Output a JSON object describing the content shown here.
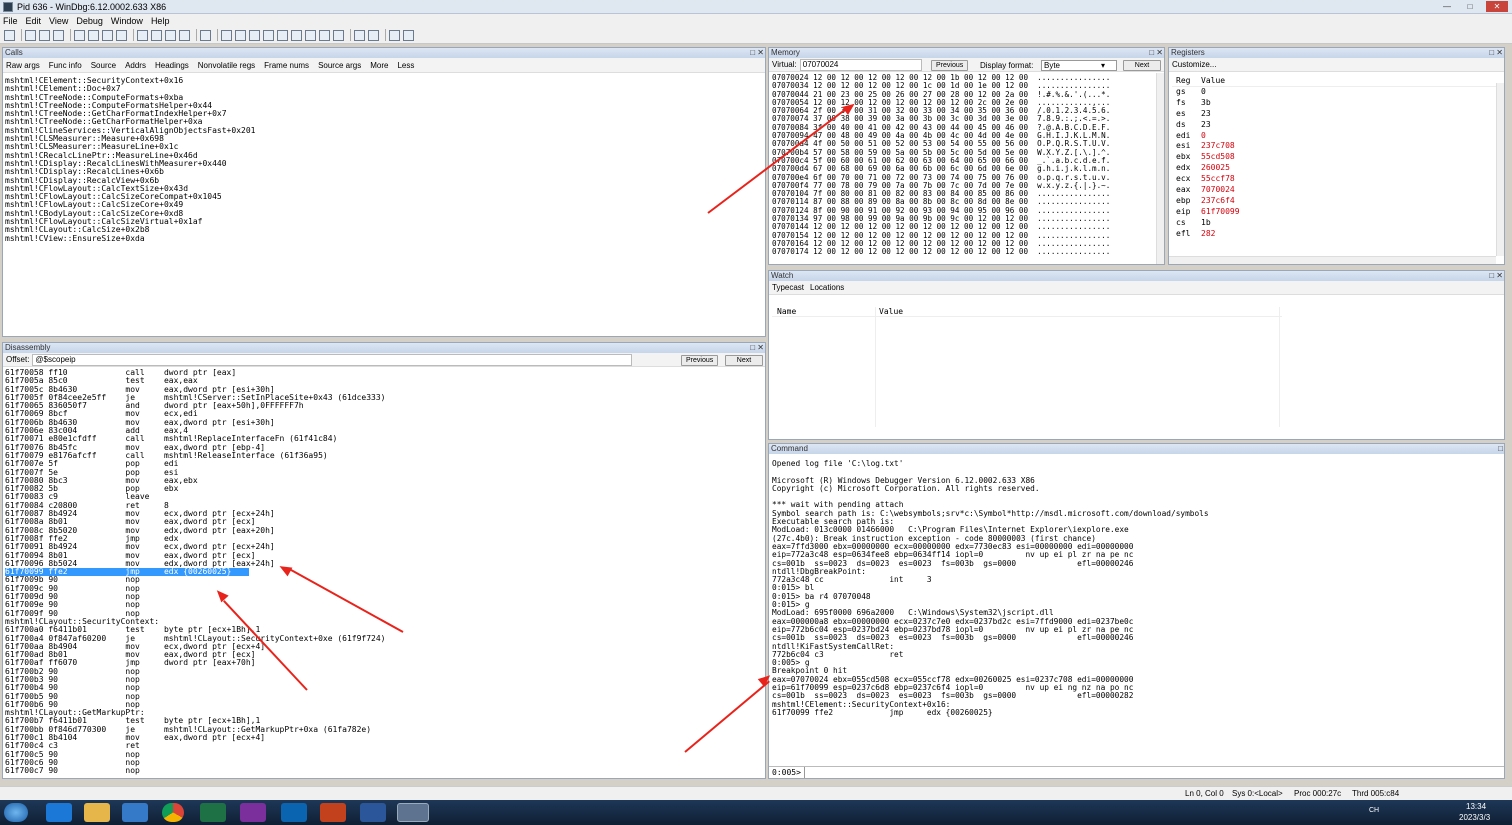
{
  "window": {
    "title": "Pid 636 - WinDbg:6.12.0002.633 X86"
  },
  "menu": [
    "File",
    "Edit",
    "View",
    "Debug",
    "Window",
    "Help"
  ],
  "calls": {
    "title": "Calls",
    "tabs": [
      "Raw args",
      "Func info",
      "Source",
      "Addrs",
      "Headings",
      "Nonvolatile regs",
      "Frame nums",
      "Source args",
      "More",
      "Less"
    ],
    "frames": [
      "mshtml!CElement::SecurityContext+0x16",
      "mshtml!CElement::Doc+0x7",
      "mshtml!CTreeNode::ComputeFormats+0xba",
      "mshtml!CTreeNode::ComputeFormatsHelper+0x44",
      "mshtml!CTreeNode::GetCharFormatIndexHelper+0x7",
      "mshtml!CTreeNode::GetCharFormatHelper+0xa",
      "mshtml!ClineServices::VerticalAlignObjectsFast+0x201",
      "mshtml!CLSMeasurer::Measure+0x698",
      "mshtml!CLSMeasurer::MeasureLine+0x1c",
      "mshtml!CRecalcLinePtr::MeasureLine+0x46d",
      "mshtml!CDisplay::RecalcLinesWithMeasurer+0x440",
      "mshtml!CDisplay::RecalcLines+0x6b",
      "mshtml!CDisplay::RecalcView+0x6b",
      "mshtml!CFlowLayout::CalcTextSize+0x43d",
      "mshtml!CFlowLayout::CalcSizeCoreCompat+0x1045",
      "mshtml!CFlowLayout::CalcSizeCore+0x49",
      "mshtml!CBodyLayout::CalcSizeCore+0xd8",
      "mshtml!CFlowLayout::CalcSizeVirtual+0x1af",
      "mshtml!CLayout::CalcSize+0x2b8",
      "mshtml!CView::EnsureSize+0xda"
    ]
  },
  "disassembly": {
    "title": "Disassembly",
    "offset_label": "Offset:",
    "offset_value": "@$scopeip",
    "previous": "Previous",
    "next": "Next",
    "lines": [
      "61f70058 ff10            call    dword ptr [eax]",
      "61f7005a 85c0            test    eax,eax",
      "61f7005c 8b4630          mov     eax,dword ptr [esi+30h]",
      "61f7005f 0f84cee2e5ff    je      mshtml!CServer::SetInPlaceSite+0x43 (61dce333)",
      "61f70065 836050f7        and     dword ptr [eax+50h],0FFFFFF7h",
      "61f70069 8bcf            mov     ecx,edi",
      "61f7006b 8b4630          mov     eax,dword ptr [esi+30h]",
      "61f7006e 83c004          add     eax,4",
      "61f70071 e80e1cfdff      call    mshtml!ReplaceInterfaceFn (61f41c84)",
      "61f70076 8b45fc          mov     eax,dword ptr [ebp-4]",
      "61f70079 e8176afcff      call    mshtml!ReleaseInterface (61f36a95)",
      "61f7007e 5f              pop     edi",
      "61f7007f 5e              pop     esi",
      "61f70080 8bc3            mov     eax,ebx",
      "61f70082 5b              pop     ebx",
      "61f70083 c9              leave",
      "61f70084 c20800          ret     8",
      "61f70087 8b4924          mov     ecx,dword ptr [ecx+24h]",
      "61f7008a 8b01            mov     eax,dword ptr [ecx]",
      "61f7008c 8b5020          mov     edx,dword ptr [eax+20h]",
      "61f7008f ffe2            jmp     edx",
      "61f70091 8b4924          mov     ecx,dword ptr [ecx+24h]",
      "61f70094 8b01            mov     eax,dword ptr [ecx]",
      "61f70096 8b5024          mov     edx,dword ptr [eax+24h]",
      "61f70099 ffe2            jmp     edx {00260025}",
      "61f7009b 90              nop",
      "61f7009c 90              nop",
      "61f7009d 90              nop",
      "61f7009e 90              nop",
      "61f7009f 90              nop",
      "mshtml!CLayout::SecurityContext:",
      "61f700a0 f6411b01        test    byte ptr [ecx+1Bh],1",
      "61f700a4 0f847af60200    je      mshtml!CLayout::SecurityContext+0xe (61f9f724)",
      "61f700aa 8b4904          mov     ecx,dword ptr [ecx+4]",
      "61f700ad 8b01            mov     eax,dword ptr [ecx]",
      "61f700af ff6070          jmp     dword ptr [eax+70h]",
      "61f700b2 90              nop",
      "61f700b3 90              nop",
      "61f700b4 90              nop",
      "61f700b5 90              nop",
      "61f700b6 90              nop",
      "mshtml!CLayout::GetMarkupPtr:",
      "61f700b7 f6411b01        test    byte ptr [ecx+1Bh],1",
      "61f700bb 0f846d770300    je      mshtml!CLayout::GetMarkupPtr+0xa (61fa782e)",
      "61f700c1 8b4104          mov     eax,dword ptr [ecx+4]",
      "61f700c4 c3              ret",
      "61f700c5 90              nop",
      "61f700c6 90              nop",
      "61f700c7 90              nop"
    ],
    "highlight_index": 24
  },
  "memory": {
    "title": "Memory",
    "virtual_label": "Virtual:",
    "virtual_value": "07070024",
    "previous": "Previous",
    "display_format_label": "Display format:",
    "display_format_value": "Byte",
    "next": "Next",
    "lines": [
      "07070024 12 00 12 00 12 00 12 00 12 00 1b 00 12 00 12 00  ................",
      "07070034 12 00 12 00 12 00 12 00 1c 00 1d 00 1e 00 12 00  ................",
      "07070044 21 00 23 00 25 00 26 00 27 00 28 00 12 00 2a 00  !.#.%.&.'.(...*.",
      "07070054 12 00 12 00 12 00 12 00 12 00 12 00 2c 00 2e 00  ............,...",
      "07070064 2f 00 30 00 31 00 32 00 33 00 34 00 35 00 36 00  /.0.1.2.3.4.5.6.",
      "07070074 37 00 38 00 39 00 3a 00 3b 00 3c 00 3d 00 3e 00  7.8.9.:.;.<.=.>.",
      "07070084 3f 00 40 00 41 00 42 00 43 00 44 00 45 00 46 00  ?.@.A.B.C.D.E.F.",
      "07070094 47 00 48 00 49 00 4a 00 4b 00 4c 00 4d 00 4e 00  G.H.I.J.K.L.M.N.",
      "070700a4 4f 00 50 00 51 00 52 00 53 00 54 00 55 00 56 00  O.P.Q.R.S.T.U.V.",
      "070700b4 57 00 58 00 59 00 5a 00 5b 00 5c 00 5d 00 5e 00  W.X.Y.Z.[.\\.].^.",
      "070700c4 5f 00 60 00 61 00 62 00 63 00 64 00 65 00 66 00  _.`.a.b.c.d.e.f.",
      "070700d4 67 00 68 00 69 00 6a 00 6b 00 6c 00 6d 00 6e 00  g.h.i.j.k.l.m.n.",
      "070700e4 6f 00 70 00 71 00 72 00 73 00 74 00 75 00 76 00  o.p.q.r.s.t.u.v.",
      "070700f4 77 00 78 00 79 00 7a 00 7b 00 7c 00 7d 00 7e 00  w.x.y.z.{.|.}.~.",
      "07070104 7f 00 80 00 81 00 82 00 83 00 84 00 85 00 86 00  ................",
      "07070114 87 00 88 00 89 00 8a 00 8b 00 8c 00 8d 00 8e 00  ................",
      "07070124 8f 00 90 00 91 00 92 00 93 00 94 00 95 00 96 00  ................",
      "07070134 97 00 98 00 99 00 9a 00 9b 00 9c 00 12 00 12 00  ................",
      "07070144 12 00 12 00 12 00 12 00 12 00 12 00 12 00 12 00  ................",
      "07070154 12 00 12 00 12 00 12 00 12 00 12 00 12 00 12 00  ................",
      "07070164 12 00 12 00 12 00 12 00 12 00 12 00 12 00 12 00  ................",
      "07070174 12 00 12 00 12 00 12 00 12 00 12 00 12 00 12 00  ................"
    ]
  },
  "registers": {
    "title": "Registers",
    "customize": "Customize...",
    "col_reg": "Reg",
    "col_value": "Value",
    "rows": [
      {
        "reg": "gs",
        "value": "0",
        "changed": false
      },
      {
        "reg": "fs",
        "value": "3b",
        "changed": false
      },
      {
        "reg": "es",
        "value": "23",
        "changed": false
      },
      {
        "reg": "ds",
        "value": "23",
        "changed": false
      },
      {
        "reg": "edi",
        "value": "0",
        "changed": true
      },
      {
        "reg": "esi",
        "value": "237c708",
        "changed": true
      },
      {
        "reg": "ebx",
        "value": "55cd508",
        "changed": true
      },
      {
        "reg": "edx",
        "value": "260025",
        "changed": true
      },
      {
        "reg": "ecx",
        "value": "55ccf78",
        "changed": true
      },
      {
        "reg": "eax",
        "value": "7070024",
        "changed": true
      },
      {
        "reg": "ebp",
        "value": "237c6f4",
        "changed": true
      },
      {
        "reg": "eip",
        "value": "61f70099",
        "changed": true
      },
      {
        "reg": "cs",
        "value": "1b",
        "changed": false
      },
      {
        "reg": "efl",
        "value": "282",
        "changed": true
      }
    ],
    "colors": {
      "changed": "#d6000b"
    }
  },
  "watch": {
    "title": "Watch",
    "tabs": [
      "Typecast",
      "Locations"
    ],
    "col_name": "Name",
    "col_value": "Value"
  },
  "command": {
    "title": "Command",
    "output": [
      "Opened log file 'C:\\log.txt'",
      "",
      "Microsoft (R) Windows Debugger Version 6.12.0002.633 X86",
      "Copyright (c) Microsoft Corporation. All rights reserved.",
      "",
      "*** wait with pending attach",
      "Symbol search path is: C:\\websymbols;srv*c:\\Symbol*http://msdl.microsoft.com/download/symbols",
      "Executable search path is:",
      "ModLoad: 013c0000 01466000   C:\\Program Files\\Internet Explorer\\iexplore.exe",
      "(27c.4b0): Break instruction exception - code 80000003 (first chance)",
      "eax=7ffd3000 ebx=00000000 ecx=00000000 edx=7730ec83 esi=00000000 edi=00000000",
      "eip=772a3c48 esp=0634fee8 ebp=0634ff14 iopl=0         nv up ei pl zr na pe nc",
      "cs=001b  ss=0023  ds=0023  es=0023  fs=003b  gs=0000             efl=00000246",
      "ntdll!DbgBreakPoint:",
      "772a3c48 cc              int     3",
      "0:015> bl",
      "0:015> ba r4 07070048",
      "0:015> g",
      "ModLoad: 695f0000 696a2000   C:\\Windows\\System32\\jscript.dll",
      "eax=000000a8 ebx=00000000 ecx=0237c7e0 edx=0237bd2c esi=7ffd9000 edi=0237be0c",
      "eip=772b6c04 esp=0237bd24 ebp=0237bd78 iopl=0         nv up ei pl zr na pe nc",
      "cs=001b  ss=0023  ds=0023  es=0023  fs=003b  gs=0000             efl=00000246",
      "ntdll!KiFastSystemCallRet:",
      "772b6c04 c3              ret",
      "0:005> g",
      "Breakpoint 0 hit",
      "eax=07070024 ebx=055cd508 ecx=055ccf78 edx=00260025 esi=0237c708 edi=00000000",
      "eip=61f70099 esp=0237c6d8 ebp=0237c6f4 iopl=0         nv up ei ng nz na po nc",
      "cs=001b  ss=0023  ds=0023  es=0023  fs=003b  gs=0000             efl=00000282",
      "mshtml!CElement::SecurityContext+0x16:",
      "61f70099 ffe2            jmp     edx {00260025}"
    ],
    "prompt": "0:005>"
  },
  "status": {
    "pos": "Ln 0, Col 0",
    "sys": "Sys 0:<Local>",
    "proc": "Proc 000:27c",
    "thrd": "Thrd 005:c84"
  },
  "tray": {
    "time": "13:34",
    "date": "2023/3/3",
    "lang": "CH"
  }
}
